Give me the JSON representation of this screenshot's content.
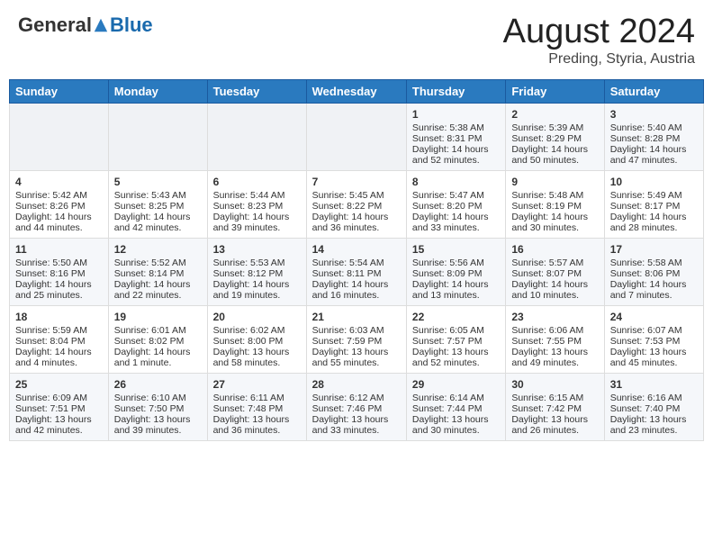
{
  "header": {
    "logo": {
      "general": "General",
      "blue": "Blue"
    },
    "month_year": "August 2024",
    "location": "Preding, Styria, Austria"
  },
  "days_of_week": [
    "Sunday",
    "Monday",
    "Tuesday",
    "Wednesday",
    "Thursday",
    "Friday",
    "Saturday"
  ],
  "weeks": [
    [
      {
        "day": "",
        "info": ""
      },
      {
        "day": "",
        "info": ""
      },
      {
        "day": "",
        "info": ""
      },
      {
        "day": "",
        "info": ""
      },
      {
        "day": "1",
        "info": "Sunrise: 5:38 AM\nSunset: 8:31 PM\nDaylight: 14 hours\nand 52 minutes."
      },
      {
        "day": "2",
        "info": "Sunrise: 5:39 AM\nSunset: 8:29 PM\nDaylight: 14 hours\nand 50 minutes."
      },
      {
        "day": "3",
        "info": "Sunrise: 5:40 AM\nSunset: 8:28 PM\nDaylight: 14 hours\nand 47 minutes."
      }
    ],
    [
      {
        "day": "4",
        "info": "Sunrise: 5:42 AM\nSunset: 8:26 PM\nDaylight: 14 hours\nand 44 minutes."
      },
      {
        "day": "5",
        "info": "Sunrise: 5:43 AM\nSunset: 8:25 PM\nDaylight: 14 hours\nand 42 minutes."
      },
      {
        "day": "6",
        "info": "Sunrise: 5:44 AM\nSunset: 8:23 PM\nDaylight: 14 hours\nand 39 minutes."
      },
      {
        "day": "7",
        "info": "Sunrise: 5:45 AM\nSunset: 8:22 PM\nDaylight: 14 hours\nand 36 minutes."
      },
      {
        "day": "8",
        "info": "Sunrise: 5:47 AM\nSunset: 8:20 PM\nDaylight: 14 hours\nand 33 minutes."
      },
      {
        "day": "9",
        "info": "Sunrise: 5:48 AM\nSunset: 8:19 PM\nDaylight: 14 hours\nand 30 minutes."
      },
      {
        "day": "10",
        "info": "Sunrise: 5:49 AM\nSunset: 8:17 PM\nDaylight: 14 hours\nand 28 minutes."
      }
    ],
    [
      {
        "day": "11",
        "info": "Sunrise: 5:50 AM\nSunset: 8:16 PM\nDaylight: 14 hours\nand 25 minutes."
      },
      {
        "day": "12",
        "info": "Sunrise: 5:52 AM\nSunset: 8:14 PM\nDaylight: 14 hours\nand 22 minutes."
      },
      {
        "day": "13",
        "info": "Sunrise: 5:53 AM\nSunset: 8:12 PM\nDaylight: 14 hours\nand 19 minutes."
      },
      {
        "day": "14",
        "info": "Sunrise: 5:54 AM\nSunset: 8:11 PM\nDaylight: 14 hours\nand 16 minutes."
      },
      {
        "day": "15",
        "info": "Sunrise: 5:56 AM\nSunset: 8:09 PM\nDaylight: 14 hours\nand 13 minutes."
      },
      {
        "day": "16",
        "info": "Sunrise: 5:57 AM\nSunset: 8:07 PM\nDaylight: 14 hours\nand 10 minutes."
      },
      {
        "day": "17",
        "info": "Sunrise: 5:58 AM\nSunset: 8:06 PM\nDaylight: 14 hours\nand 7 minutes."
      }
    ],
    [
      {
        "day": "18",
        "info": "Sunrise: 5:59 AM\nSunset: 8:04 PM\nDaylight: 14 hours\nand 4 minutes."
      },
      {
        "day": "19",
        "info": "Sunrise: 6:01 AM\nSunset: 8:02 PM\nDaylight: 14 hours\nand 1 minute."
      },
      {
        "day": "20",
        "info": "Sunrise: 6:02 AM\nSunset: 8:00 PM\nDaylight: 13 hours\nand 58 minutes."
      },
      {
        "day": "21",
        "info": "Sunrise: 6:03 AM\nSunset: 7:59 PM\nDaylight: 13 hours\nand 55 minutes."
      },
      {
        "day": "22",
        "info": "Sunrise: 6:05 AM\nSunset: 7:57 PM\nDaylight: 13 hours\nand 52 minutes."
      },
      {
        "day": "23",
        "info": "Sunrise: 6:06 AM\nSunset: 7:55 PM\nDaylight: 13 hours\nand 49 minutes."
      },
      {
        "day": "24",
        "info": "Sunrise: 6:07 AM\nSunset: 7:53 PM\nDaylight: 13 hours\nand 45 minutes."
      }
    ],
    [
      {
        "day": "25",
        "info": "Sunrise: 6:09 AM\nSunset: 7:51 PM\nDaylight: 13 hours\nand 42 minutes."
      },
      {
        "day": "26",
        "info": "Sunrise: 6:10 AM\nSunset: 7:50 PM\nDaylight: 13 hours\nand 39 minutes."
      },
      {
        "day": "27",
        "info": "Sunrise: 6:11 AM\nSunset: 7:48 PM\nDaylight: 13 hours\nand 36 minutes."
      },
      {
        "day": "28",
        "info": "Sunrise: 6:12 AM\nSunset: 7:46 PM\nDaylight: 13 hours\nand 33 minutes."
      },
      {
        "day": "29",
        "info": "Sunrise: 6:14 AM\nSunset: 7:44 PM\nDaylight: 13 hours\nand 30 minutes."
      },
      {
        "day": "30",
        "info": "Sunrise: 6:15 AM\nSunset: 7:42 PM\nDaylight: 13 hours\nand 26 minutes."
      },
      {
        "day": "31",
        "info": "Sunrise: 6:16 AM\nSunset: 7:40 PM\nDaylight: 13 hours\nand 23 minutes."
      }
    ]
  ]
}
